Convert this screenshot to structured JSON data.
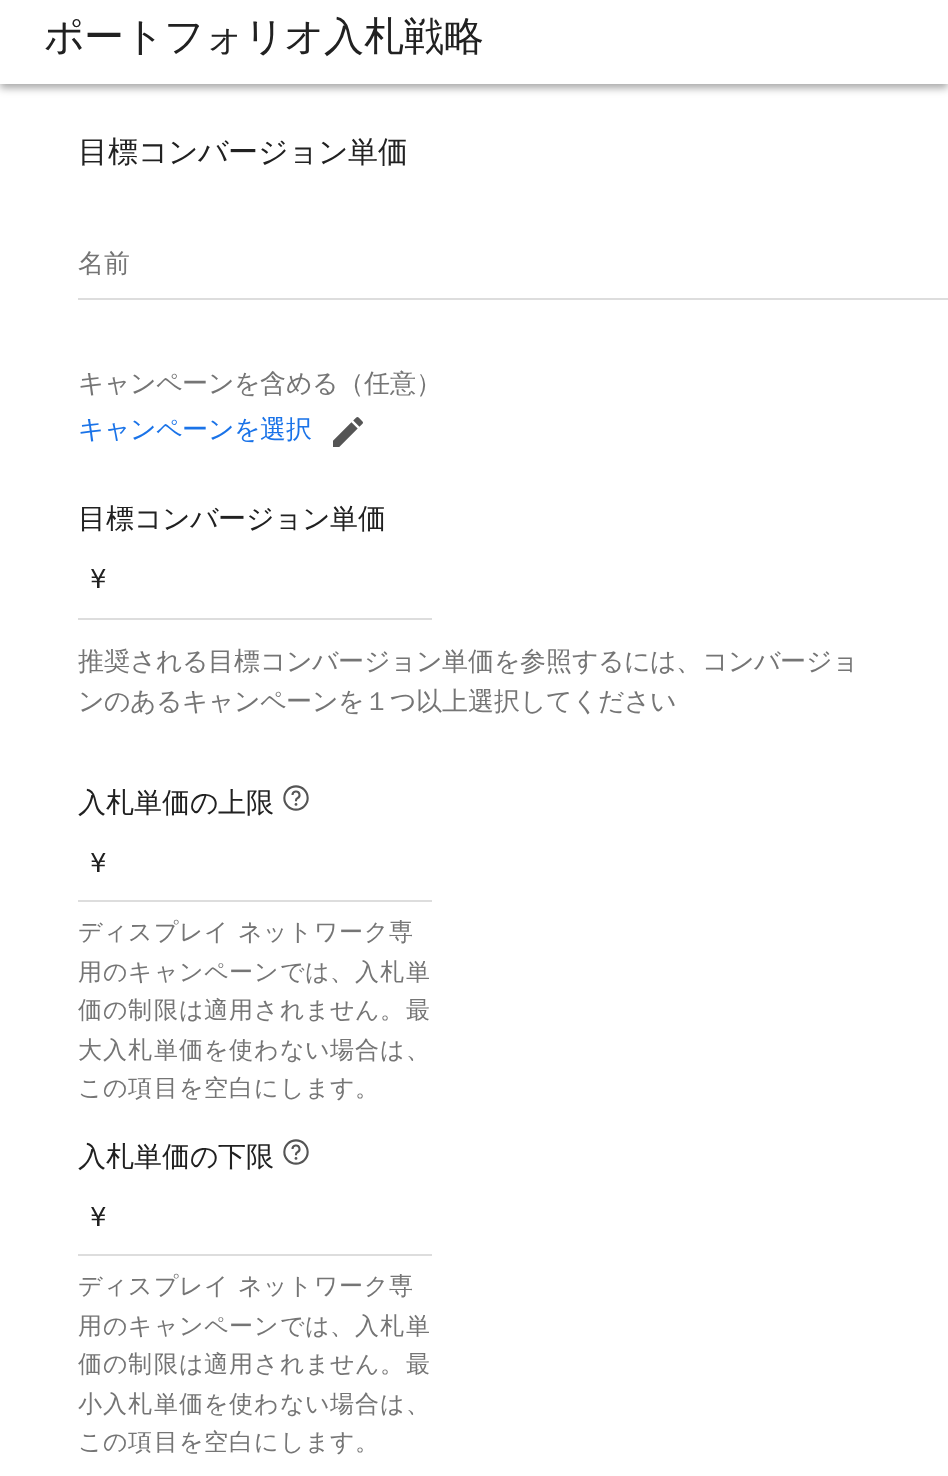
{
  "header": {
    "title": "ポートフォリオ入札戦略"
  },
  "section_title": "目標コンバージョン単価",
  "name_field": {
    "placeholder": "名前"
  },
  "campaigns": {
    "label": "キャンペーンを含める（任意）",
    "link": "キャンペーンを選択"
  },
  "amount_fields": [
    {
      "kind": "wide",
      "label": "目標コンバージョン単価",
      "help": false,
      "prefix": "¥",
      "hint": "推奨される目標コンバージョン単価を参照するには、コンバージョンのあるキャンペーンを１つ以上選択してください"
    },
    {
      "kind": "narrow",
      "label": "入札単価の上限",
      "help": true,
      "prefix": "¥",
      "hint": "ディスプレイ ネットワーク専用のキャンペーンでは、入札単価の制限は適用されません。最大入札単価を使わない場合は、この項目を空白にします。"
    },
    {
      "kind": "narrow",
      "label": "入札単価の下限",
      "help": true,
      "prefix": "¥",
      "hint": "ディスプレイ ネットワーク専用のキャンペーンでは、入札単価の制限は適用されません。最小入札単価を使わない場合は、この項目を空白にします。"
    }
  ]
}
